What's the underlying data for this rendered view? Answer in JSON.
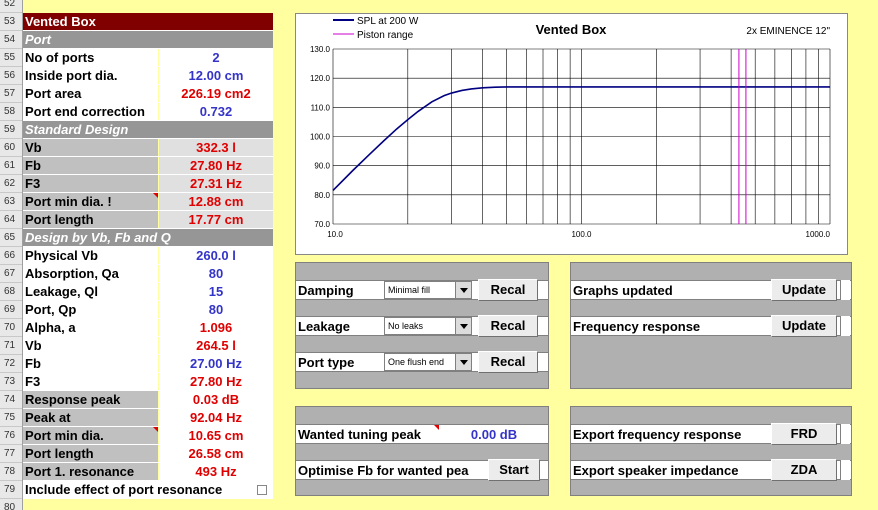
{
  "row_numbers": [
    "52",
    "53",
    "54",
    "55",
    "56",
    "57",
    "58",
    "59",
    "60",
    "61",
    "62",
    "63",
    "64",
    "65",
    "66",
    "67",
    "68",
    "69",
    "70",
    "71",
    "72",
    "73",
    "74",
    "75",
    "76",
    "77",
    "78",
    "79",
    "80"
  ],
  "table": {
    "title": "Vented Box",
    "port_header": "Port",
    "no_of_ports": {
      "label": "No of ports",
      "value": "2"
    },
    "inside_port_dia": {
      "label": "Inside port dia.",
      "value": "12.00 cm"
    },
    "port_area": {
      "label": "Port area",
      "value": "226.19 cm2"
    },
    "port_end_correction": {
      "label": "Port end correction",
      "value": "0.732"
    },
    "standard_header": "Standard Design",
    "std_vb": {
      "label": "Vb",
      "value": "332.3 l"
    },
    "std_fb": {
      "label": "Fb",
      "value": "27.80 Hz"
    },
    "std_f3": {
      "label": "F3",
      "value": "27.31 Hz"
    },
    "std_port_min_dia": {
      "label": "Port min dia. !",
      "value": "12.88 cm"
    },
    "std_port_length": {
      "label": "Port length",
      "value": "17.77 cm"
    },
    "design_header": "Design by Vb, Fb and Q",
    "physical_vb": {
      "label": "Physical Vb",
      "value": "260.0 l"
    },
    "absorption": {
      "label": "Absorption, Qa",
      "value": "80"
    },
    "leakage": {
      "label": "Leakage, Ql",
      "value": "15"
    },
    "port_qp": {
      "label": "Port, Qp",
      "value": "80"
    },
    "alpha": {
      "label": "Alpha, a",
      "value": "1.096"
    },
    "d_vb": {
      "label": "Vb",
      "value": "264.5 l"
    },
    "d_fb": {
      "label": "Fb",
      "value": "27.00 Hz"
    },
    "d_f3": {
      "label": "F3",
      "value": "27.80 Hz"
    },
    "response_peak": {
      "label": "Response peak",
      "value": "0.03 dB"
    },
    "peak_at": {
      "label": "Peak at",
      "value": "92.04 Hz"
    },
    "d_port_min_dia": {
      "label": "Port min dia.",
      "value": "10.65 cm"
    },
    "d_port_length": {
      "label": "Port length",
      "value": "26.58 cm"
    },
    "port_resonance": {
      "label": "Port 1. resonance",
      "value": "493 Hz"
    },
    "include_effect": {
      "label": "Include effect of port resonance"
    }
  },
  "panels": {
    "damping": {
      "label": "Damping",
      "select": "Minimal fill",
      "button": "Recal"
    },
    "leakage": {
      "label": "Leakage",
      "select": "No leaks",
      "button": "Recal"
    },
    "port_type": {
      "label": "Port type",
      "select": "One flush end",
      "button": "Recal"
    },
    "graphs_updated": {
      "label": "Graphs updated",
      "button": "Update"
    },
    "frequency_response": {
      "label": "Frequency response",
      "button": "Update"
    },
    "wanted_tuning_peak": {
      "label": "Wanted tuning peak",
      "value": "0.00 dB"
    },
    "optimise_fb": {
      "label": "Optimise Fb for wanted pea",
      "button": "Start"
    },
    "export_freq": {
      "label": "Export frequency response",
      "button": "FRD"
    },
    "export_imp": {
      "label": "Export speaker impedance",
      "button": "ZDA"
    }
  },
  "colors": {
    "title_bg": "#800000",
    "section_bg": "#969696",
    "value_blue": "#3434c8",
    "value_red": "#e00000",
    "sheet_bg": "#ffffa0",
    "curve": "#000080",
    "piston": "#cc00cc"
  },
  "chart_data": {
    "type": "line",
    "title": "Vented Box",
    "subtitle": "2x EMINENCE 12\"",
    "x_scale": "log",
    "xlim": [
      10,
      1000
    ],
    "ylim": [
      70,
      130
    ],
    "x_ticks": [
      "10.0",
      "100.0",
      "1000.0"
    ],
    "y_ticks": [
      "70.0",
      "80.0",
      "90.0",
      "100.0",
      "110.0",
      "120.0",
      "130.0"
    ],
    "grid": true,
    "legend_position": "top-left",
    "series": [
      {
        "name": "SPL at 200 W",
        "color": "#000080",
        "x": [
          10,
          12,
          14,
          16,
          18,
          20,
          22,
          25,
          28,
          30,
          33,
          36,
          40,
          45,
          50,
          60,
          80,
          100,
          200,
          500,
          1000
        ],
        "y": [
          81.5,
          88.3,
          93.8,
          98.5,
          102.5,
          105.8,
          108.6,
          111.9,
          114.0,
          114.9,
          115.8,
          116.3,
          116.7,
          116.9,
          117.0,
          117.0,
          117.0,
          117.0,
          117.0,
          117.0,
          117.0
        ]
      },
      {
        "name": "Piston range",
        "color": "#cc00cc",
        "x": [
          430,
          430
        ],
        "y": [
          70,
          130
        ]
      }
    ]
  }
}
